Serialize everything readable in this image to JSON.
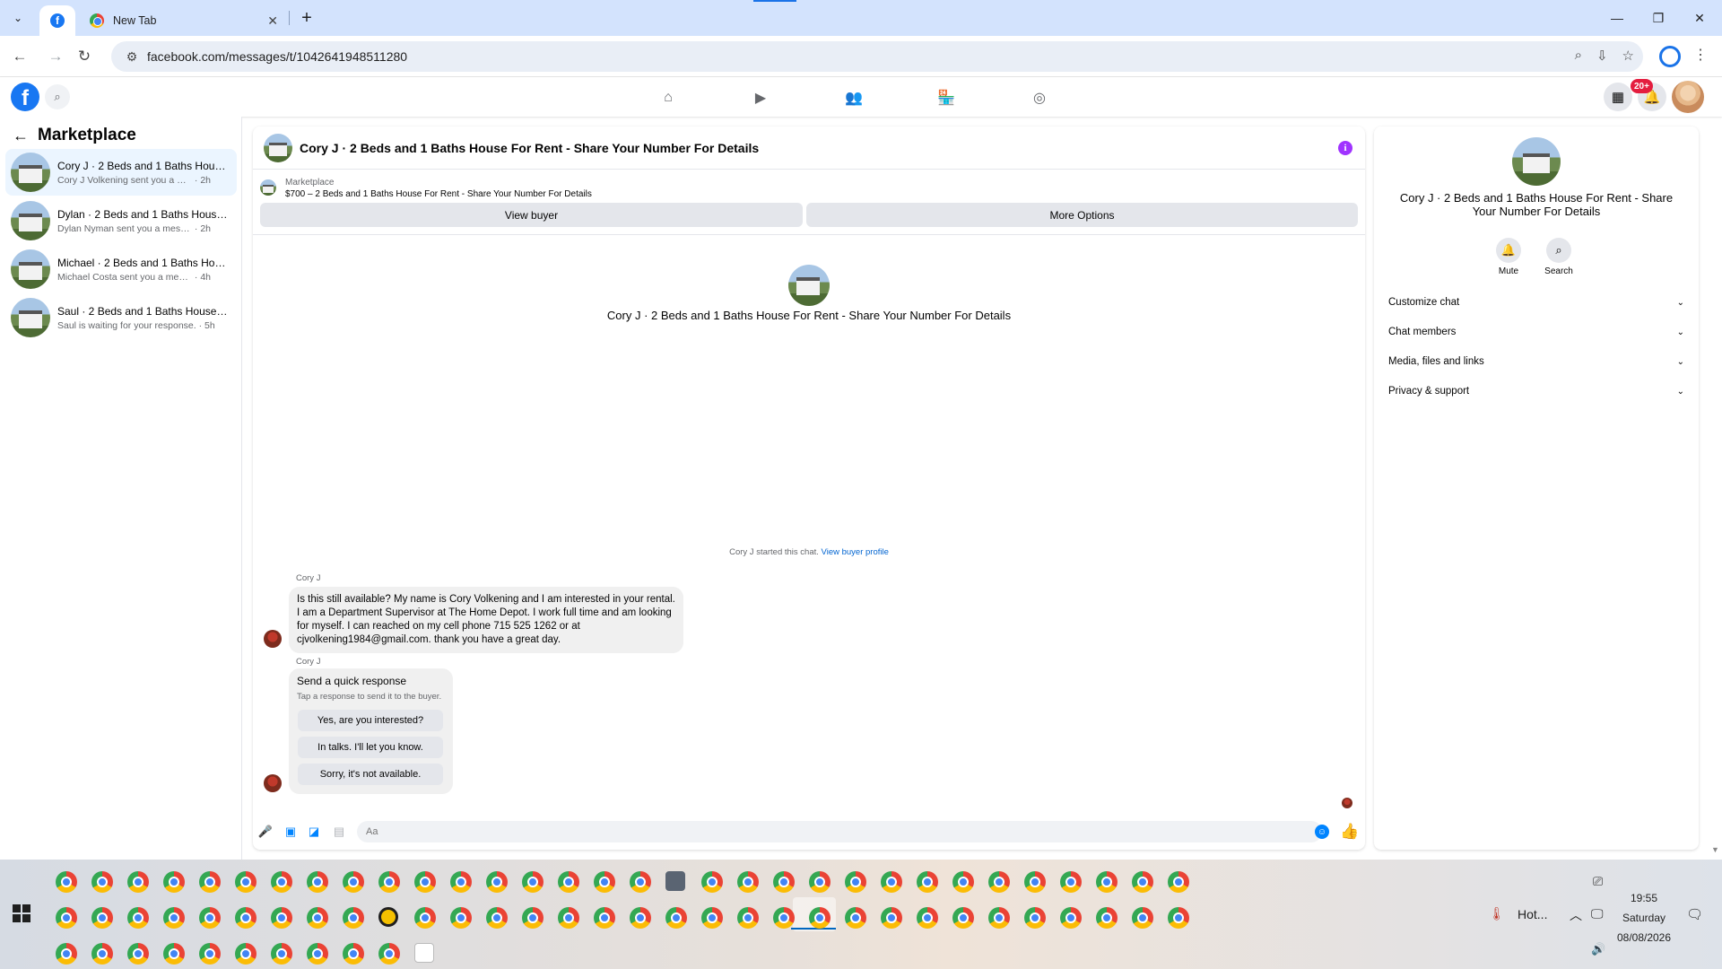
{
  "browser": {
    "tabs": [
      {
        "title": "",
        "favicon": "facebook-icon",
        "active": true
      },
      {
        "title": "New Tab",
        "favicon": "chrome-icon",
        "active": false
      }
    ],
    "url": "facebook.com/messages/t/1042641948511280",
    "window_controls": {
      "minimize": "—",
      "restore": "❐",
      "close": "✕"
    }
  },
  "fb": {
    "notification_badge": "20+",
    "colors": {
      "brand": "#1877f2",
      "accent": "#0084ff",
      "badge": "#e41e3f",
      "info": "#a033ff"
    }
  },
  "sidebar": {
    "title": "Marketplace",
    "items": [
      {
        "name": "Cory J · 2 Beds and 1 Baths House ...",
        "snippet": "Cory J Volkening sent you a message ...",
        "time": "2h",
        "active": true
      },
      {
        "name": "Dylan · 2 Beds and 1 Baths House ...",
        "snippet": "Dylan Nyman sent you a message abo...",
        "time": "2h",
        "active": false
      },
      {
        "name": "Michael · 2 Beds and 1 Baths Hous...",
        "snippet": "Michael Costa sent you a message ab...",
        "time": "4h",
        "active": false
      },
      {
        "name": "Saul · 2 Beds and 1 Baths House Fo...",
        "snippet": "Saul is waiting for your response.",
        "time": "5h",
        "active": false
      }
    ]
  },
  "chat": {
    "title": "Cory J · 2 Beds and 1 Baths House For Rent - Share Your Number For Details",
    "marketplace_label": "Marketplace",
    "listing": "$700 – 2 Beds and 1 Baths House For Rent - Share Your Number For Details",
    "view_buyer": "View buyer",
    "more_options": "More Options",
    "intro_title": "Cory J · 2 Beds and 1 Baths House For Rent - Share Your Number For Details",
    "started_text": "Cory J started this chat.",
    "started_link": "View buyer profile",
    "sender": "Cory J",
    "message": "Is this still available? My name is Cory Volkening and I am interested in your rental. I am a Department Supervisor at The Home Depot. I work full time and am looking for myself. I can reached on my cell phone 715 525 1262 or at cjvolkening1984@gmail.com. thank you have a great day.",
    "quick_title": "Send a quick response",
    "quick_sub": "Tap a response to send it to the buyer.",
    "quick_replies": [
      "Yes, are you interested?",
      "In talks. I'll let you know.",
      "Sorry, it's not available."
    ],
    "composer_placeholder": "Aa"
  },
  "details": {
    "title": "Cory J · 2 Beds and 1 Baths House For Rent - Share Your Number For Details",
    "mute": "Mute",
    "search": "Search",
    "sections": [
      "Customize chat",
      "Chat members",
      "Media, files and links",
      "Privacy & support"
    ]
  },
  "taskbar": {
    "weather": "Hot...",
    "time": "19:55",
    "day": "Saturday",
    "date": "08/08/2026"
  }
}
